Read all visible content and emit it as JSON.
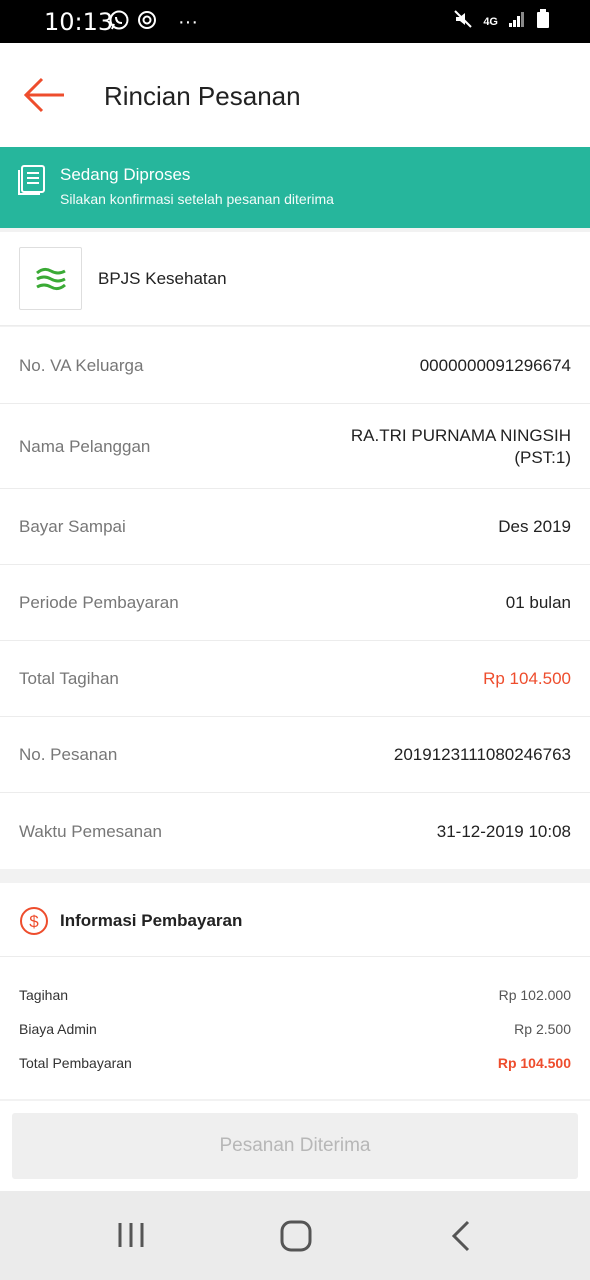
{
  "status_bar": {
    "time": "10:13",
    "network": "4G"
  },
  "header": {
    "title": "Rincian Pesanan"
  },
  "status_banner": {
    "title": "Sedang Diproses",
    "subtitle": "Silakan konfirmasi setelah pesanan diterima"
  },
  "provider": {
    "name": "BPJS Kesehatan"
  },
  "details": [
    {
      "label": "No. VA Keluarga",
      "value": "0000000091296674"
    },
    {
      "label": "Nama Pelanggan",
      "value_line1": "RA.TRI PURNAMA NINGSIH",
      "value_line2": "(PST:1)"
    },
    {
      "label": "Bayar Sampai",
      "value": "Des 2019"
    },
    {
      "label": "Periode Pembayaran",
      "value": "01 bulan"
    },
    {
      "label": "Total Tagihan",
      "value": "Rp 104.500"
    },
    {
      "label": "No. Pesanan",
      "value": "2019123111080246763"
    },
    {
      "label": "Waktu Pemesanan",
      "value": "31-12-2019 10:08"
    }
  ],
  "payment_info": {
    "title": "Informasi Pembayaran",
    "lines": [
      {
        "label": "Tagihan",
        "value": "Rp 102.000"
      },
      {
        "label": "Biaya Admin",
        "value": "Rp 2.500"
      },
      {
        "label": "Total Pembayaran",
        "value": "Rp 104.500"
      }
    ]
  },
  "confirm_button": {
    "label": "Pesanan Diterima"
  },
  "colors": {
    "accent": "#ee4d2d",
    "banner": "#26b69c"
  },
  "icons": [
    "whatsapp-icon",
    "sync-icon",
    "more-icon",
    "mute-icon",
    "signal-icon",
    "battery-icon",
    "back-arrow-icon",
    "document-icon",
    "bpjs-logo",
    "dollar-icon",
    "recent-apps-icon",
    "home-icon",
    "nav-back-icon"
  ]
}
